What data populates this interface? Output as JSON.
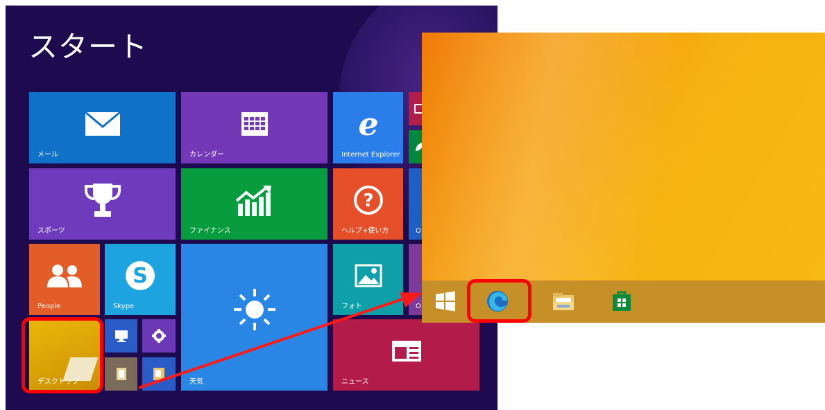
{
  "start_screen": {
    "title": "スタート",
    "tiles": {
      "mail": "メール",
      "calendar": "カレンダー",
      "internet_explorer": "Internet Explorer",
      "sports": "スポーツ",
      "finance": "ファイナンス",
      "help": "ヘルプ+使い方",
      "people": "People",
      "skype": "Skype",
      "weather": "天気",
      "photos": "フォト",
      "desktop": "デスクトップ",
      "news": "ニュース",
      "cut_o1": "O",
      "cut_o2": "O"
    }
  },
  "desktop": {
    "taskbar": {
      "items": [
        "start-button",
        "edge-icon",
        "file-explorer-icon",
        "store-icon"
      ]
    }
  },
  "colors": {
    "start_bg": "#1d0a4f",
    "highlight": "#ff0000",
    "taskbar": "#c68f27"
  }
}
